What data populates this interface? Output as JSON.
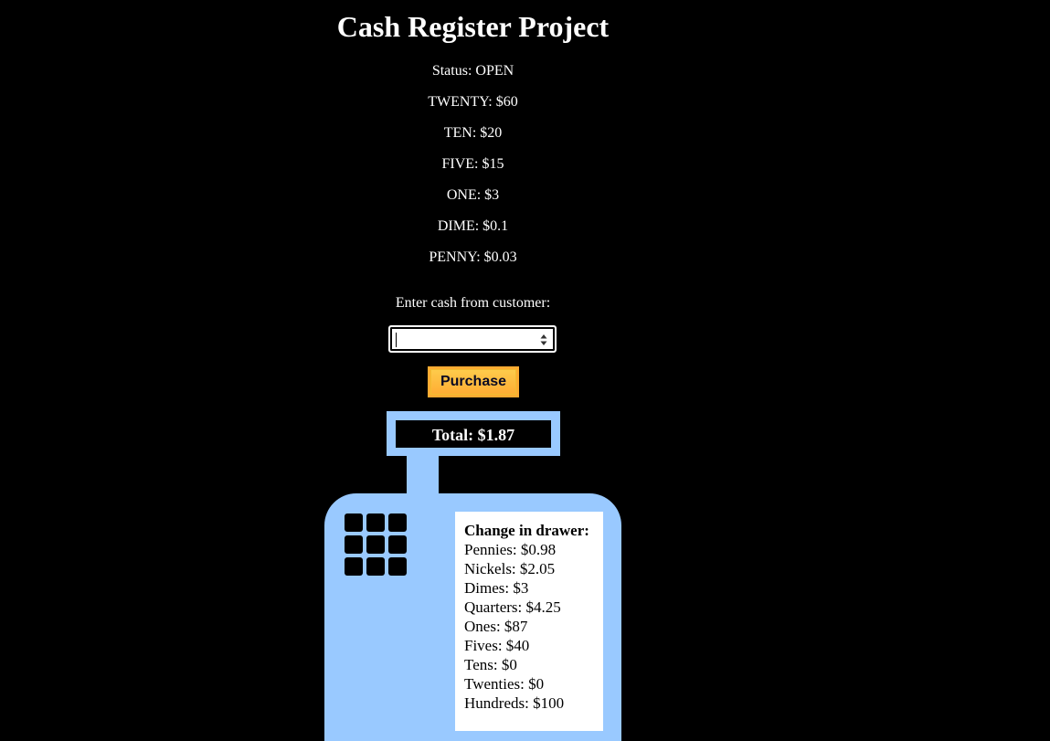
{
  "header": {
    "title": "Cash Register Project"
  },
  "status": {
    "status_text": "Status: OPEN",
    "lines": [
      "TWENTY: $60",
      "TEN: $20",
      "FIVE: $15",
      "ONE: $3",
      "DIME: $0.1",
      "PENNY: $0.03"
    ]
  },
  "form": {
    "cash_label": "Enter cash from customer:",
    "cash_value": "",
    "purchase_label": "Purchase"
  },
  "register": {
    "total_text": "Total: $1.87",
    "drawer_title": "Change in drawer:",
    "drawer_items": [
      "Pennies: $0.98",
      "Nickels: $2.05",
      "Dimes: $3",
      "Quarters: $4.25",
      "Ones: $87",
      "Fives: $40",
      "Tens: $0",
      "Twenties: $0",
      "Hundreds: $100"
    ]
  },
  "colors": {
    "background": "#000000",
    "register_blue": "#99c9ff",
    "button_orange": "#feac32"
  }
}
